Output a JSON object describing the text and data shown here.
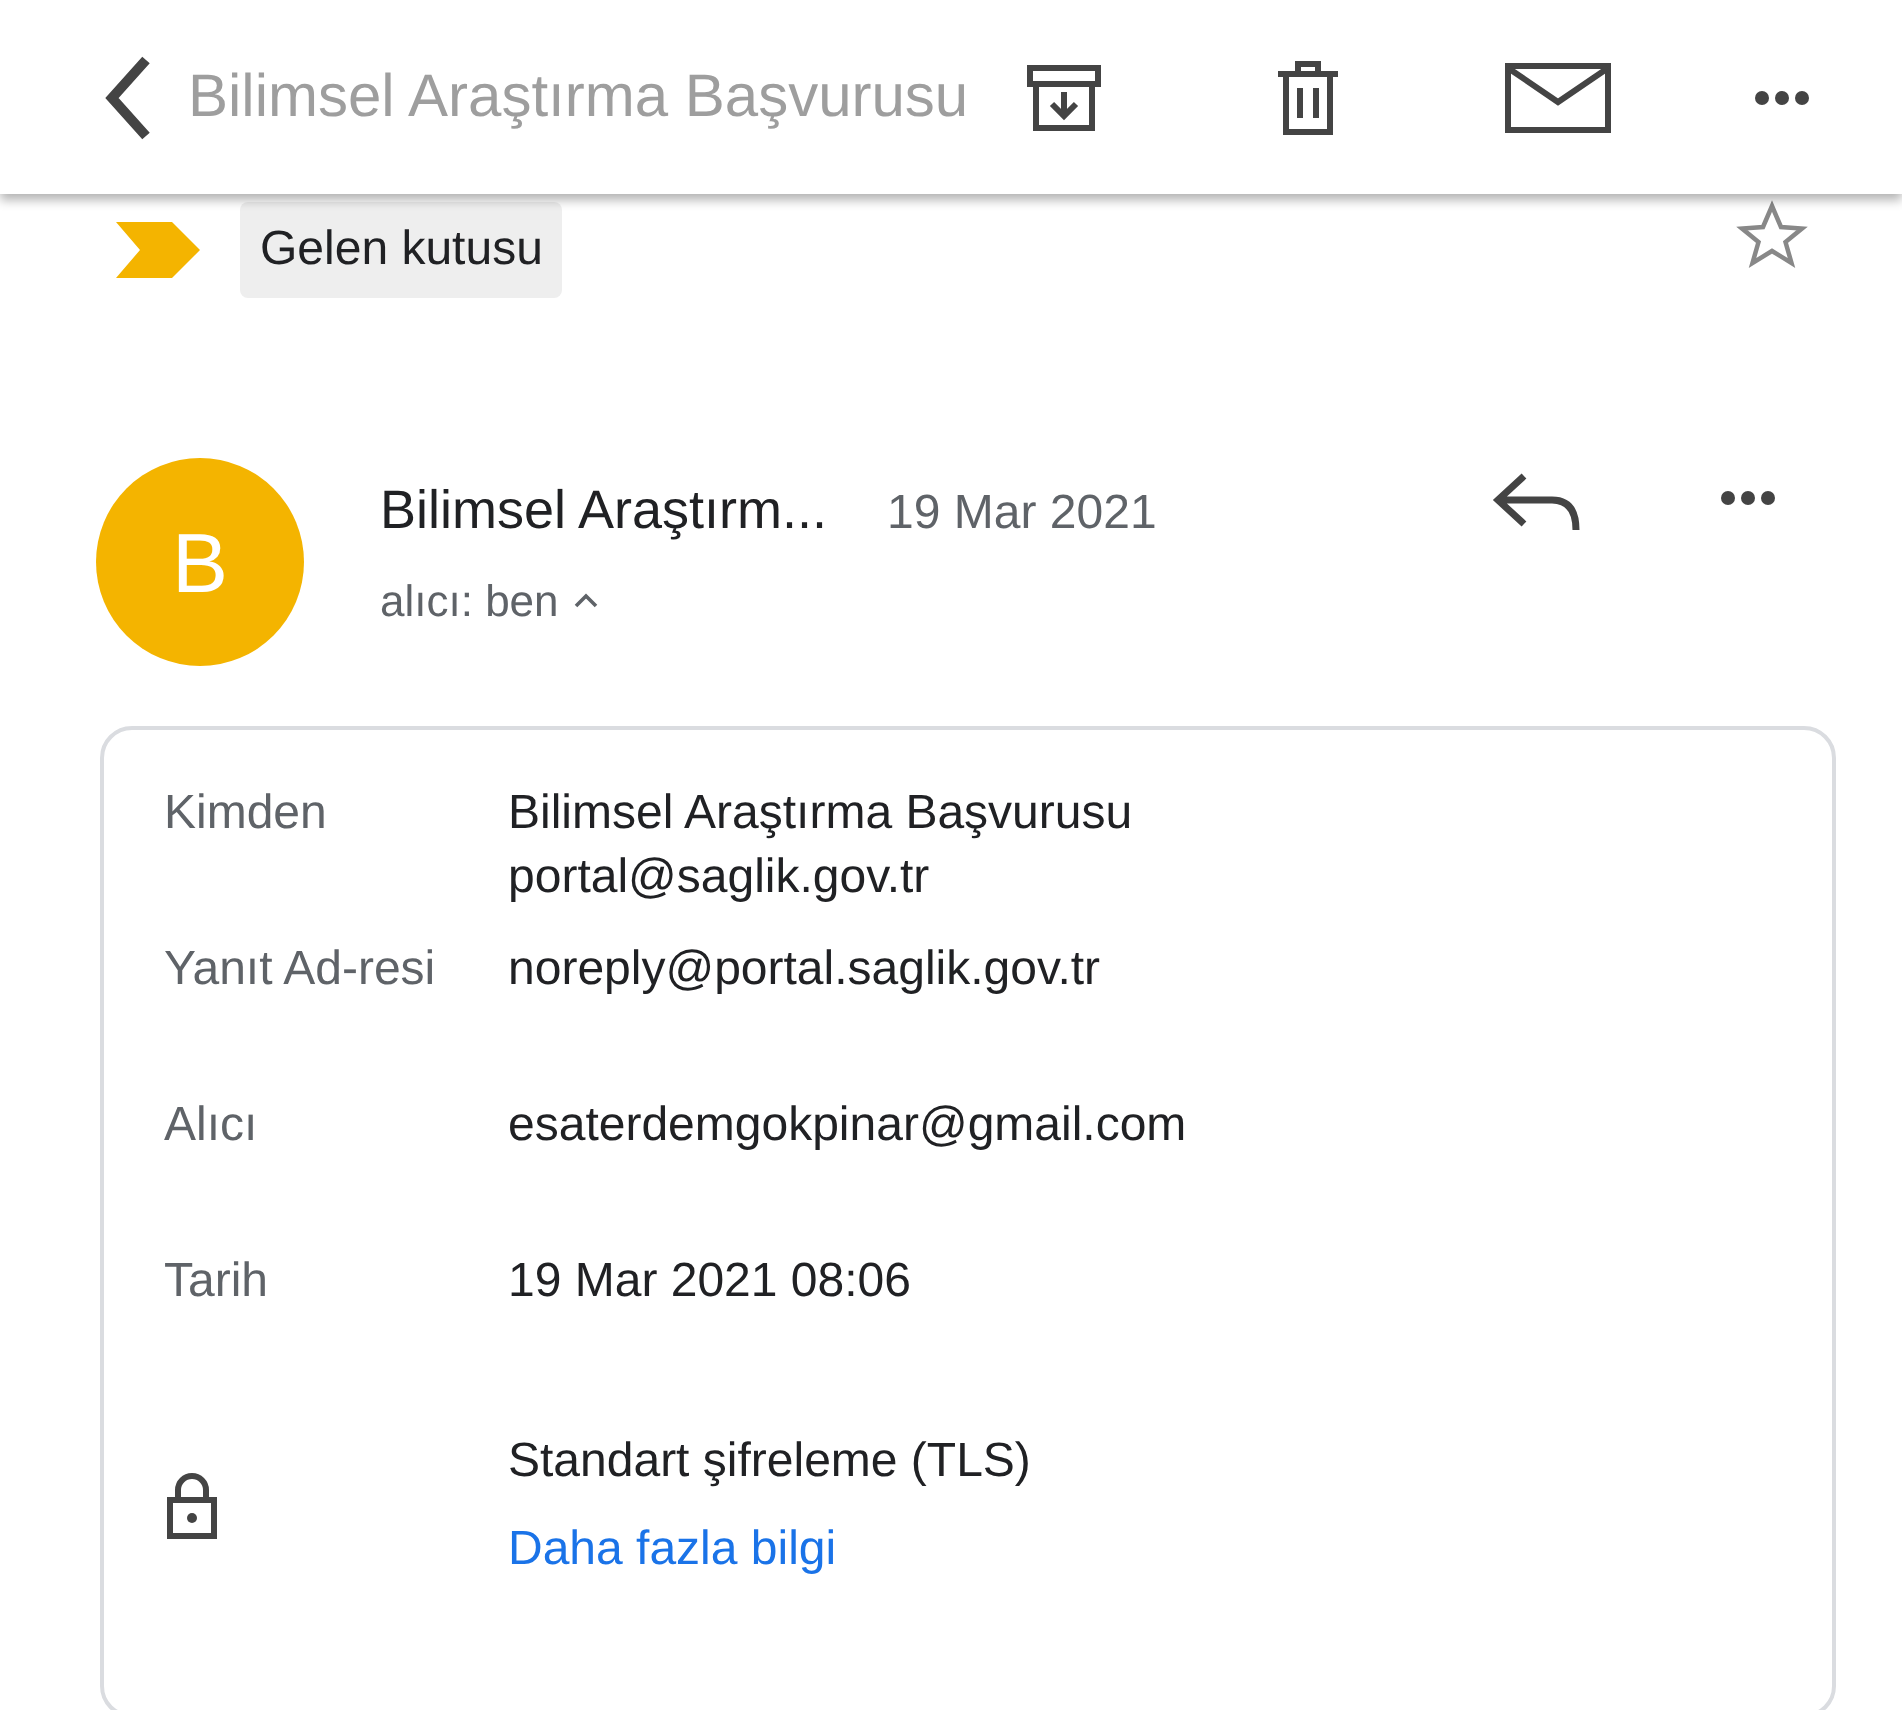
{
  "toolbar": {
    "title": "Bilimsel Araştırma Başvurusu",
    "starred": false
  },
  "labels": [
    {
      "text": "Gelen kutusu"
    }
  ],
  "message": {
    "avatar": "B",
    "sender": "Bilimsel Araştırm...",
    "date": "19 Mar 2021",
    "recipient_line": "alıcı: ben",
    "expanded": true
  },
  "details": [
    {
      "label": "Kimden",
      "lines": [
        "Bilimsel Araştırma Başvurusu",
        "portal@saglik.gov.tr"
      ]
    },
    {
      "label": "Yanıt Ad-resi",
      "lines": [
        "noreply@portal.saglik.gov.tr"
      ]
    },
    {
      "label": "Alıcı",
      "lines": [
        "esaterdemgokpinar@gmail.com"
      ]
    },
    {
      "label": "Tarih",
      "lines": [
        "19 Mar 2021 08:06"
      ]
    }
  ],
  "security": {
    "text": "Standart şifreleme (TLS)",
    "link": "Daha fazla bilgi"
  }
}
